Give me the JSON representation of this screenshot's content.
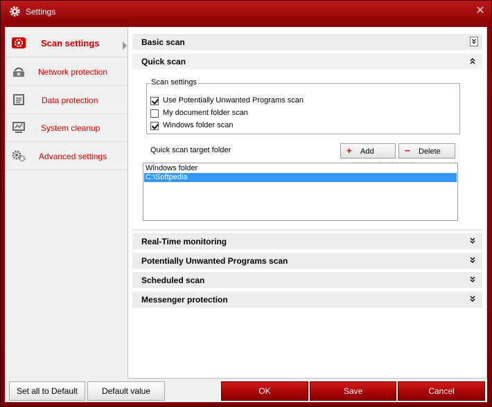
{
  "window": {
    "title": "Settings",
    "close_glyph": "✕"
  },
  "sidebar": {
    "items": [
      {
        "label": "Scan settings",
        "icon": "scan-gear-icon"
      },
      {
        "label": "Network protection",
        "icon": "network-icon"
      },
      {
        "label": "Data protection",
        "icon": "document-icon"
      },
      {
        "label": "System cleanup",
        "icon": "monitor-icon"
      },
      {
        "label": "Advanced settings",
        "icon": "gears-icon"
      }
    ]
  },
  "sections": {
    "basic_scan": "Basic scan",
    "quick_scan": "Quick scan",
    "real_time": "Real-Time monitoring",
    "pup_scan": "Potentially Unwanted Programs scan",
    "scheduled": "Scheduled scan",
    "messenger": "Messenger protection"
  },
  "quick_scan": {
    "group_title": "Scan settings",
    "options": [
      {
        "label": "Use Potentially Unwanted Programs scan",
        "checked": true
      },
      {
        "label": "My document folder scan",
        "checked": false
      },
      {
        "label": "Windows folder scan",
        "checked": true
      }
    ],
    "target_label": "Quick scan target folder",
    "add_label": "Add",
    "delete_label": "Delete",
    "folders": [
      "Windows folder",
      "C:\\Softpedia"
    ],
    "watermark": "www.softpedia.com"
  },
  "footer": {
    "set_default": "Set all to Default",
    "default_value": "Default value",
    "ok": "OK",
    "save": "Save",
    "cancel": "Cancel"
  },
  "colors": {
    "accent": "#d40000",
    "titlebar": "#a80a0a",
    "selection": "#3399ff"
  }
}
